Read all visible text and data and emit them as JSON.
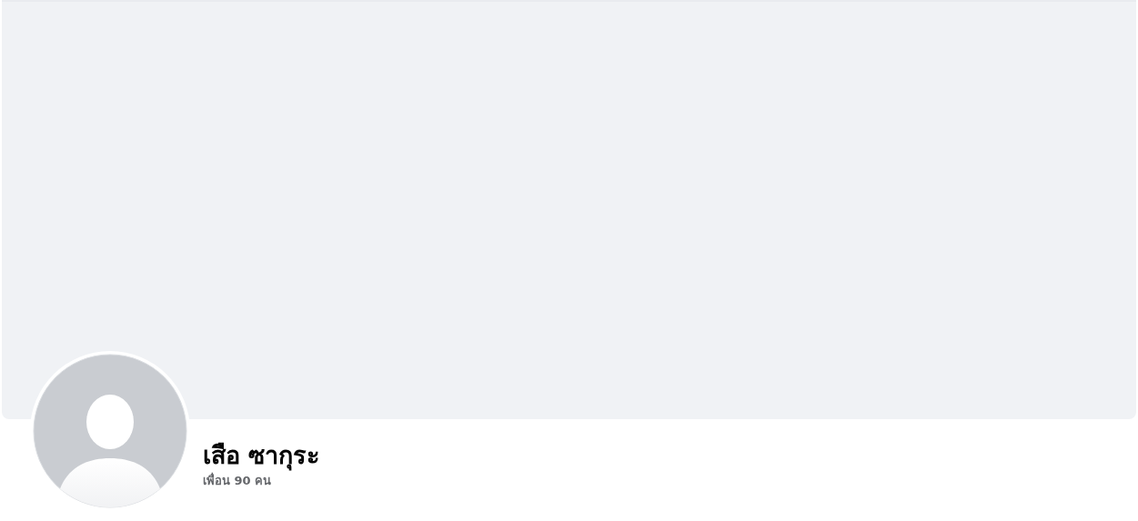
{
  "cover": {
    "kind": "empty"
  },
  "profile": {
    "name": "เสือ ซากุระ",
    "friends": "เพื่อน 90 คน"
  }
}
